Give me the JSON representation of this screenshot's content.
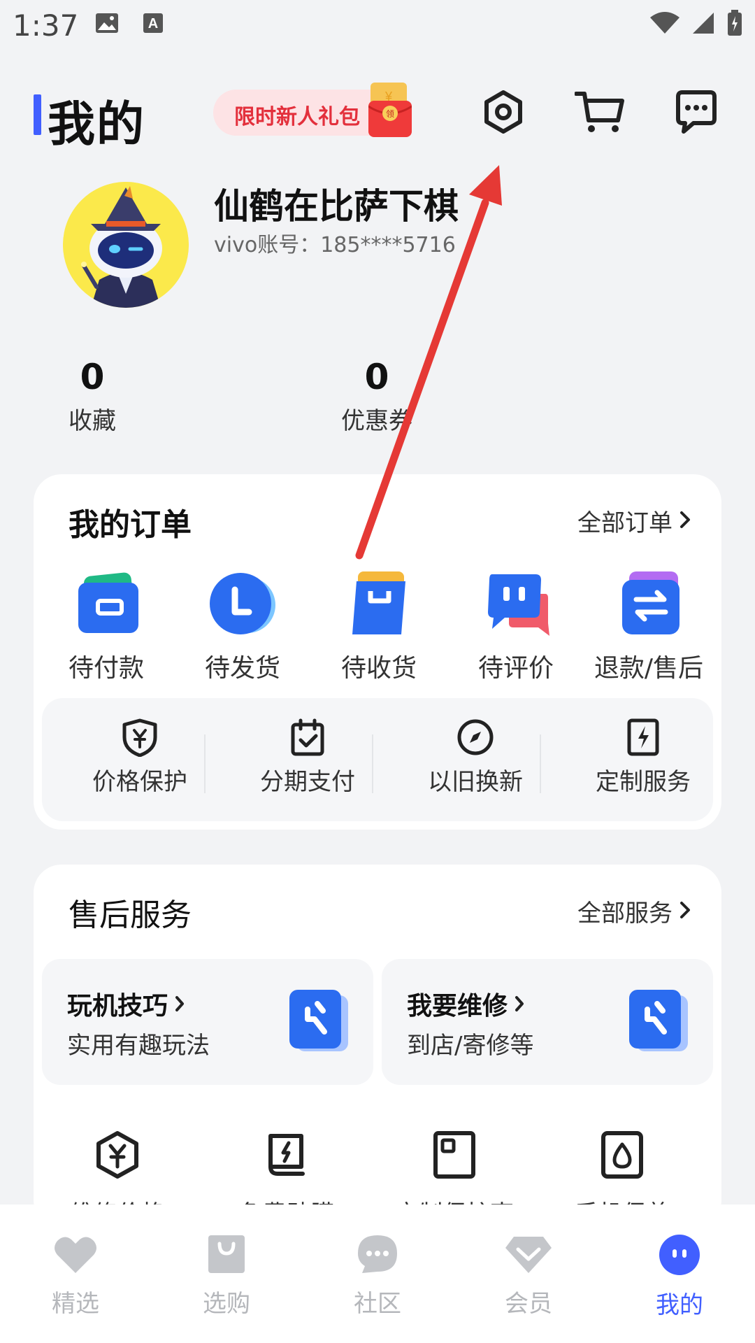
{
  "status_bar": {
    "time": "1:37"
  },
  "header": {
    "title": "我的",
    "promo_label": "限时新人礼包",
    "promo_badge": "领"
  },
  "profile": {
    "nickname": "仙鹤在比萨下棋",
    "account": "vivo账号：185****5716"
  },
  "stats": [
    {
      "value": "0",
      "label": "收藏"
    },
    {
      "value": "0",
      "label": "优惠券"
    }
  ],
  "orders": {
    "title": "我的订单",
    "all_link": "全部订单",
    "items": [
      {
        "label": "待付款",
        "icon": "wallet-icon"
      },
      {
        "label": "待发货",
        "icon": "clock-icon"
      },
      {
        "label": "待收货",
        "icon": "package-icon"
      },
      {
        "label": "待评价",
        "icon": "comment-icon"
      },
      {
        "label": "退款/售后",
        "icon": "refund-icon"
      }
    ],
    "services": [
      {
        "label": "价格保护",
        "icon": "shield-yuan-icon"
      },
      {
        "label": "分期支付",
        "icon": "calendar-check-icon"
      },
      {
        "label": "以旧换新",
        "icon": "compass-icon"
      },
      {
        "label": "定制服务",
        "icon": "lightning-card-icon"
      }
    ]
  },
  "after_sales": {
    "title": "售后服务",
    "all_link": "全部服务",
    "cards": [
      {
        "title": "玩机技巧",
        "subtitle": "实用有趣玩法",
        "icon": "wrench-icon"
      },
      {
        "title": "我要维修",
        "subtitle": "到店/寄修等",
        "icon": "wrench-icon"
      }
    ],
    "items": [
      {
        "label": "维修价格",
        "icon": "price-hexagon-icon"
      },
      {
        "label": "免费贴膜",
        "icon": "screen-film-icon"
      },
      {
        "label": "定制保护壳",
        "icon": "phone-case-icon"
      },
      {
        "label": "手机保养",
        "icon": "droplet-icon"
      }
    ]
  },
  "bottom_nav": [
    {
      "label": "精选",
      "icon": "heart-icon",
      "active": false
    },
    {
      "label": "选购",
      "icon": "shopping-bag-icon",
      "active": false
    },
    {
      "label": "社区",
      "icon": "chat-bubble-icon",
      "active": false
    },
    {
      "label": "会员",
      "icon": "diamond-icon",
      "active": false
    },
    {
      "label": "我的",
      "icon": "profile-dots-icon",
      "active": true
    }
  ],
  "colors": {
    "accent": "#415fff",
    "promo_text": "#e3303c",
    "annotation_arrow": "#e53935",
    "nav_inactive": "#b5b7bb"
  }
}
